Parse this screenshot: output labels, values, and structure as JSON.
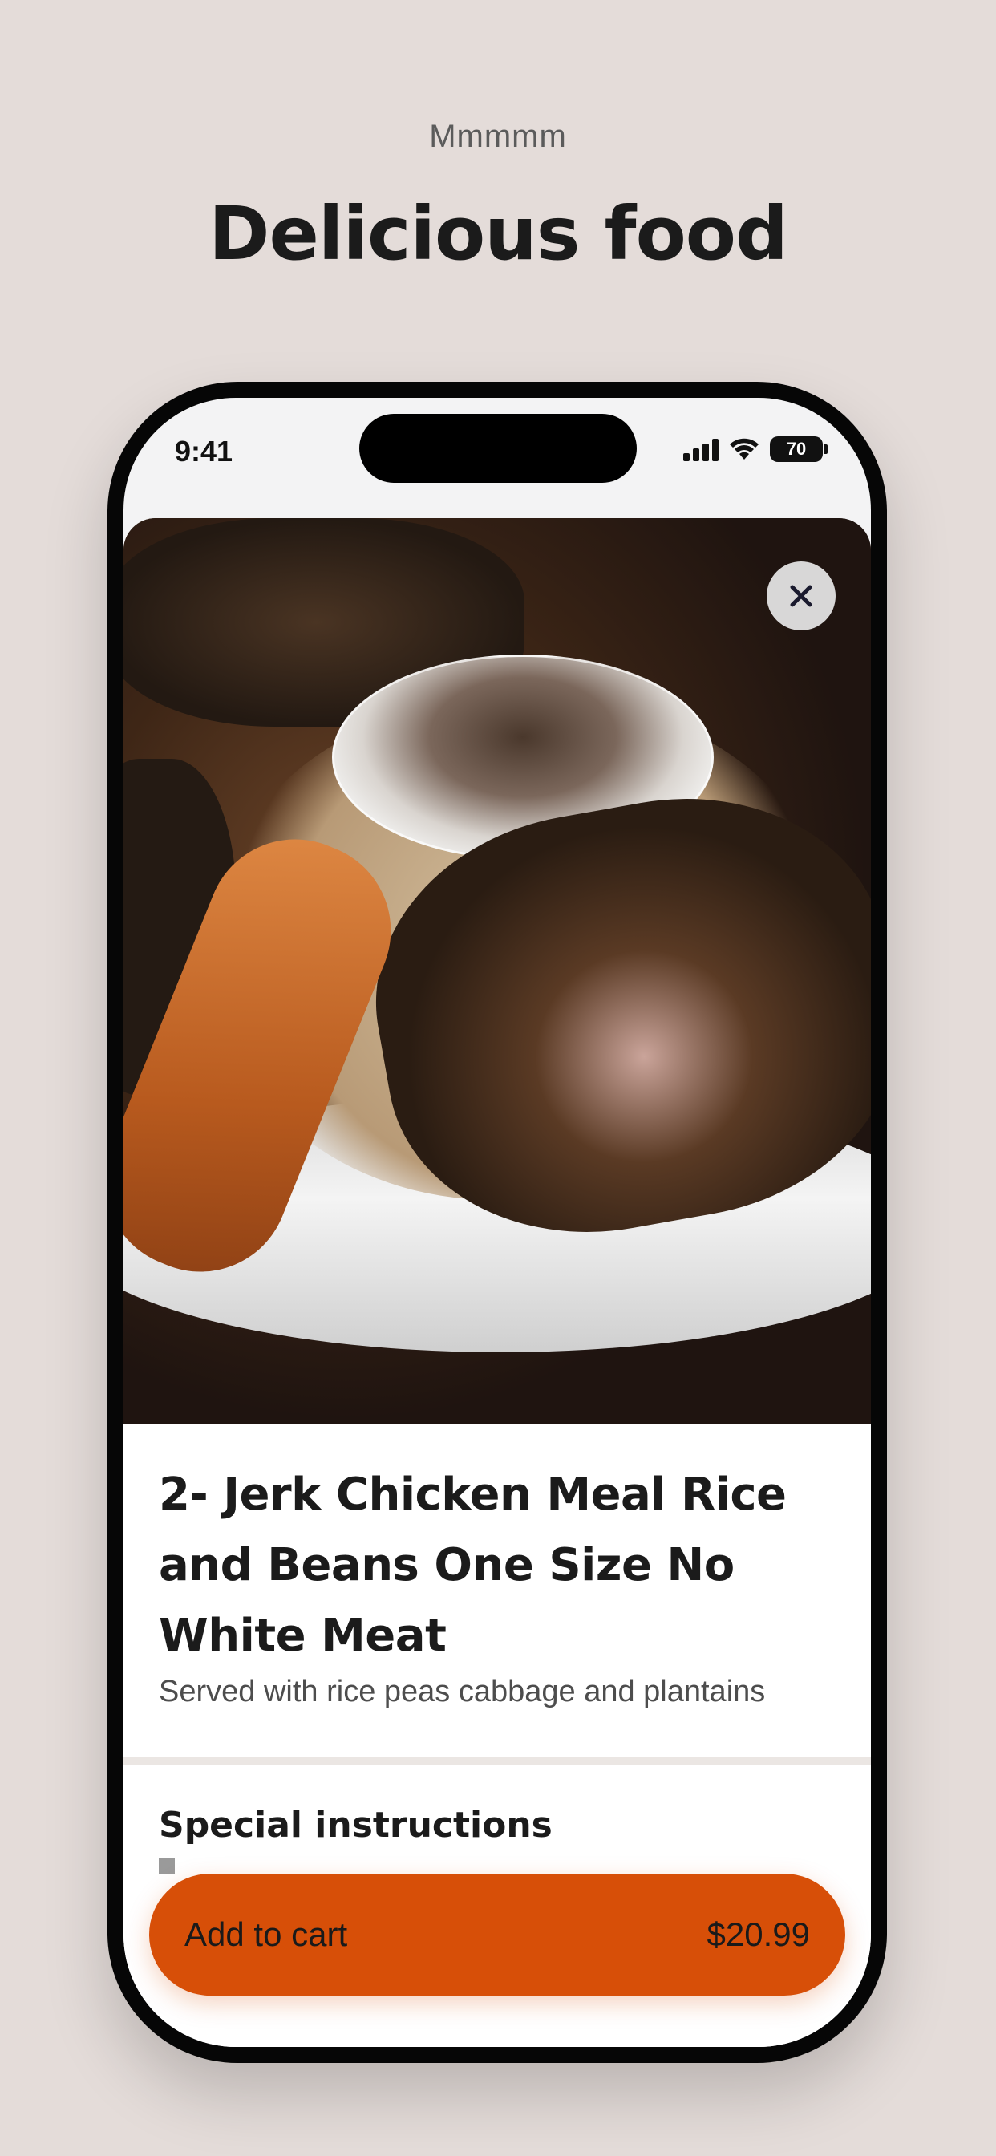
{
  "hero": {
    "eyebrow": "Mmmmm",
    "title": "Delicious food"
  },
  "status_bar": {
    "time": "9:41",
    "battery": "70",
    "icons": [
      "signal-icon",
      "wifi-icon",
      "battery-icon"
    ]
  },
  "item": {
    "title": "2- Jerk Chicken Meal Rice and Beans One Size No White Meat",
    "description": "Served with rice peas cabbage and plantains",
    "image": "food-photo",
    "close_icon": "close-icon"
  },
  "special_instructions": {
    "heading": "Special instructions"
  },
  "cart": {
    "label": "Add to cart",
    "price": "$20.99"
  },
  "colors": {
    "background": "#e4dcd9",
    "accent": "#d74f08"
  }
}
